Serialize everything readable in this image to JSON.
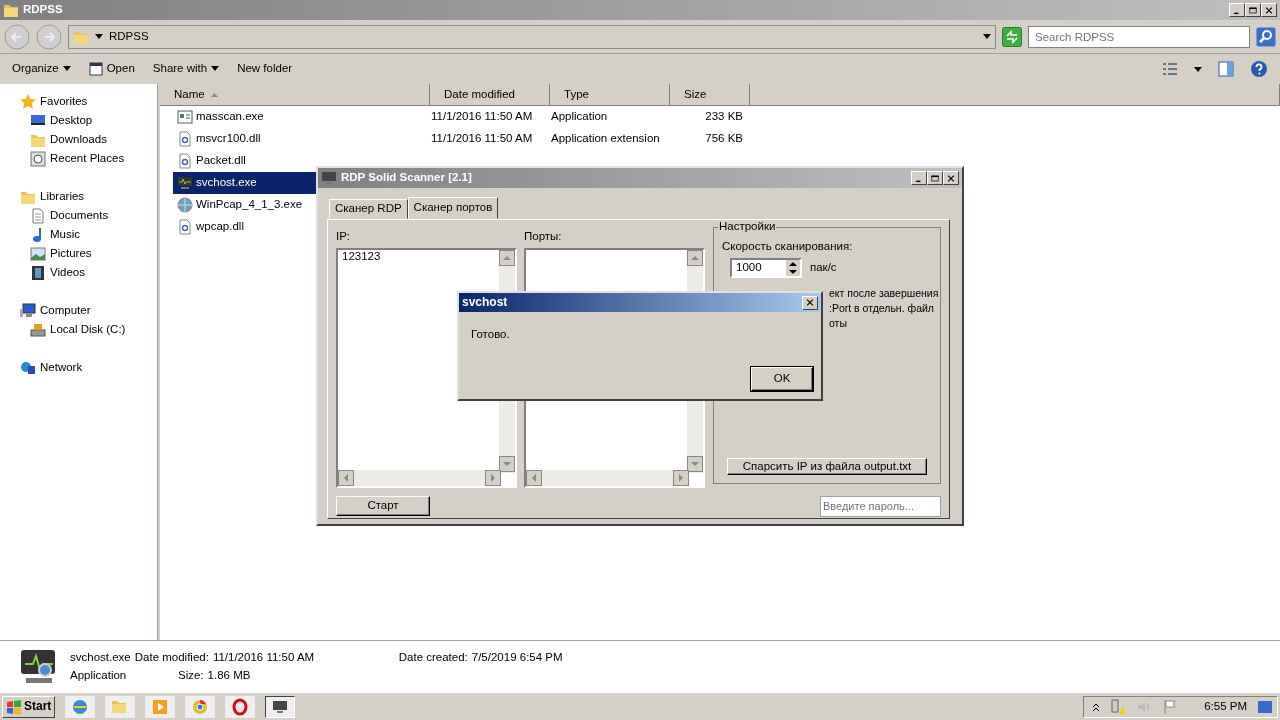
{
  "window": {
    "title": "RDPSS"
  },
  "address": {
    "path": "RDPSS"
  },
  "search": {
    "placeholder": "Search RDPSS"
  },
  "toolbar": [
    {
      "label": "Organize",
      "dropdown": true
    },
    {
      "label": "Open",
      "dropdown": false
    },
    {
      "label": "Share with",
      "dropdown": true
    },
    {
      "label": "New folder",
      "dropdown": false
    }
  ],
  "nav": [
    {
      "label": "Favorites",
      "children": [
        {
          "label": "Desktop"
        },
        {
          "label": "Downloads"
        },
        {
          "label": "Recent Places"
        }
      ]
    },
    {
      "label": "Libraries",
      "children": [
        {
          "label": "Documents"
        },
        {
          "label": "Music"
        },
        {
          "label": "Pictures"
        },
        {
          "label": "Videos"
        }
      ]
    },
    {
      "label": "Computer",
      "children": [
        {
          "label": "Local Disk (C:)"
        }
      ]
    },
    {
      "label": "Network"
    }
  ],
  "columns": [
    {
      "label": "Name",
      "sorted": true
    },
    {
      "label": "Date modified",
      "sorted": false
    },
    {
      "label": "Type",
      "sorted": false
    },
    {
      "label": "Size",
      "sorted": false
    }
  ],
  "files": [
    {
      "name": "masscan.exe",
      "date": "11/1/2016 11:50 AM",
      "type": "Application",
      "size": "233 KB",
      "kind": "app",
      "selected": false
    },
    {
      "name": "msvcr100.dll",
      "date": "11/1/2016 11:50 AM",
      "type": "Application extension",
      "size": "756 KB",
      "kind": "dll",
      "selected": false
    },
    {
      "name": "Packet.dll",
      "kind": "dll",
      "selected": false
    },
    {
      "name": "svchost.exe",
      "kind": "monitor",
      "selected": true
    },
    {
      "name": "WinPcap_4_1_3.exe",
      "kind": "installer",
      "selected": false
    },
    {
      "name": "wpcap.dll",
      "kind": "dll",
      "selected": false
    }
  ],
  "details": {
    "name": "svchost.exe",
    "type": "Application",
    "fields": [
      {
        "label": "Date modified:",
        "value": "11/1/2016 11:50 AM"
      },
      {
        "label": "Date created:",
        "value": "7/5/2019 6:54 PM"
      },
      {
        "label": "Size:",
        "value": "1.86 MB"
      }
    ]
  },
  "scanner": {
    "title": "RDP Solid Scanner [2.1]",
    "tabs": [
      {
        "label": "Сканер RDP",
        "selected": false
      },
      {
        "label": "Сканер портов",
        "selected": true
      }
    ],
    "ip_label": "IP:",
    "ip_value": "123123",
    "ports_label": "Порты:",
    "settings": {
      "title": "Настройки",
      "speed_label": "Скорость сканирования:",
      "speed_value": "1000",
      "unit": "пак/с",
      "options": [
        {
          "text": "ект после завершения"
        },
        {
          "text": ":Port в отдельн. файл"
        },
        {
          "text": "оты"
        }
      ],
      "parse_button": "Спарсить IP из файла output.txt"
    },
    "start_button": "Старт",
    "password_placeholder": "Введите пароль..."
  },
  "dialog": {
    "title": "svchost",
    "message": "Готово.",
    "button": "OK"
  },
  "taskbar": {
    "start": "Start",
    "apps": [
      {
        "active": false
      },
      {
        "active": false
      },
      {
        "active": false
      },
      {
        "active": false
      },
      {
        "active": false
      },
      {
        "active": true
      }
    ],
    "clock": "6:55 PM"
  }
}
